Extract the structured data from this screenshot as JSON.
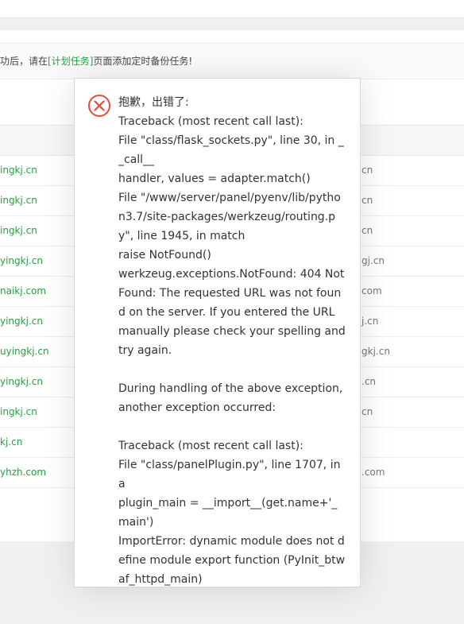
{
  "notice": {
    "prefix": "功后，请在",
    "link": "[计划任务]",
    "suffix": "页面添加定时备份任务!"
  },
  "rows": [
    {
      "left": "ingkj.cn",
      "right": "cn"
    },
    {
      "left": "ingkj.cn",
      "right": "cn"
    },
    {
      "left": "ingkj.cn",
      "right": "cn"
    },
    {
      "left": "yingkj.cn",
      "right": "gj.cn"
    },
    {
      "left": "naikj.com",
      "right": "com"
    },
    {
      "left": "yingkj.cn",
      "right": "j.cn"
    },
    {
      "left": "uyingkj.cn",
      "right": "gkj.cn"
    },
    {
      "left": "yingkj.cn",
      "right": ".cn"
    },
    {
      "left": "ingkj.cn",
      "right": "cn"
    },
    {
      "left": "kj.cn",
      "right": ""
    },
    {
      "left": "yhzh.com",
      "right": ".com"
    }
  ],
  "dialog": {
    "icon": "error-circle-x-icon",
    "icon_color": "#e74c3c",
    "lines": [
      "抱歉，出错了:",
      "Traceback (most recent call last):",
      "File \"class/flask_sockets.py\", line 30, in __call__",
      "handler, values = adapter.match()",
      "File \"/www/server/panel/pyenv/lib/python3.7/site-packages/werkzeug/routing.py\", line 1945, in match",
      "raise NotFound()",
      "werkzeug.exceptions.NotFound: 404 Not Found: The requested URL was not found on the server. If you entered the URL manually please check your spelling and try again.",
      "",
      "During handling of the above exception, another exception occurred:",
      "",
      "Traceback (most recent call last):",
      "File \"class/panelPlugin.py\", line 1707, in a",
      "plugin_main = __import__(get.name+'_main')",
      "ImportError: dynamic module does not define module export function (PyInit_btwaf_httpd_main)"
    ]
  },
  "colors": {
    "link_green": "#20a53a",
    "error_red": "#e74c3c"
  }
}
